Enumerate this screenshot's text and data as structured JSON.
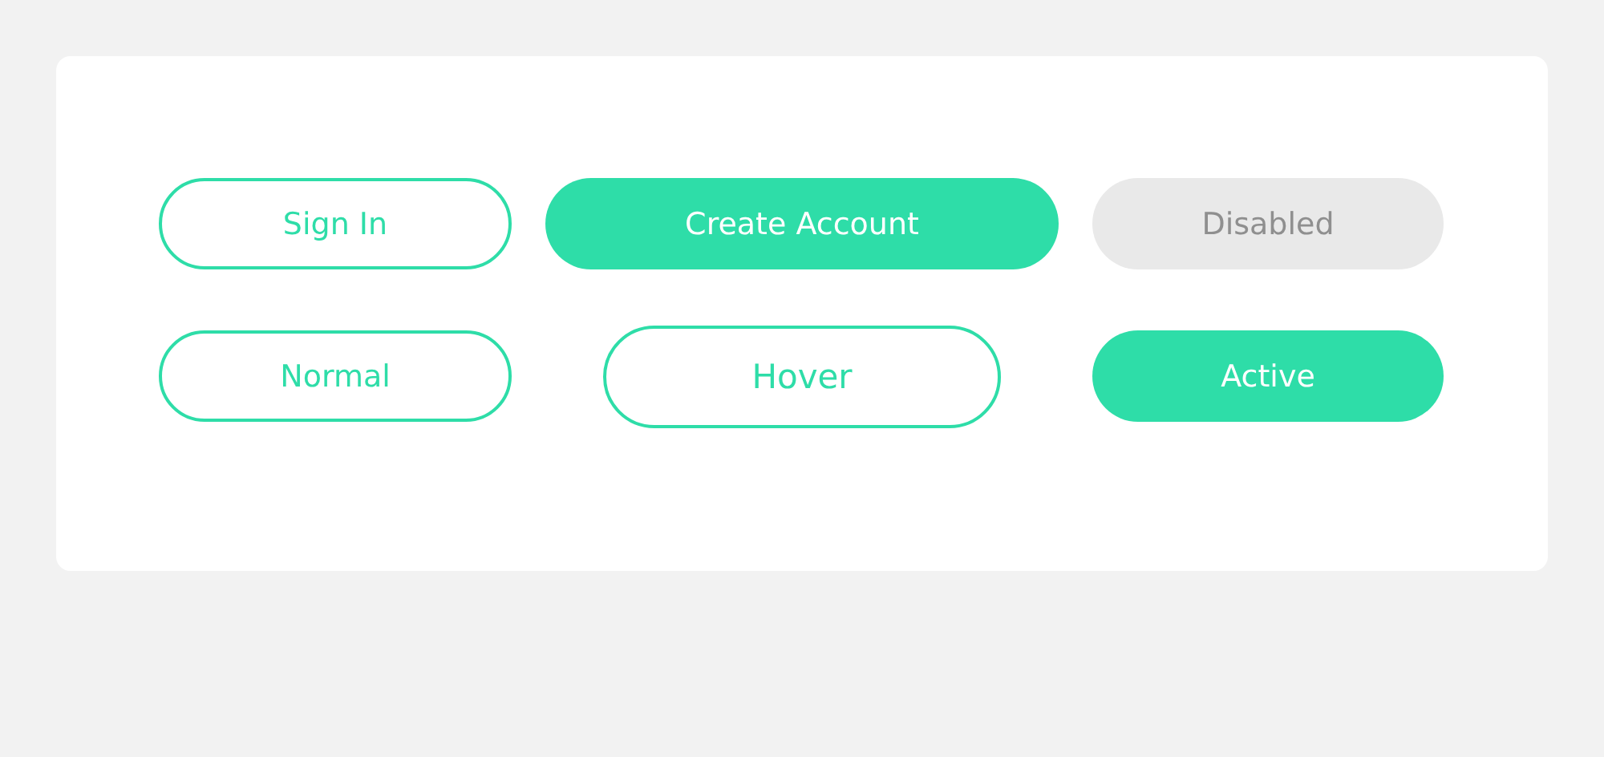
{
  "buttons": [
    {
      "label": "Sign In",
      "kind": "outline"
    },
    {
      "label": "Create Account",
      "kind": "filled"
    },
    {
      "label": "Disabled",
      "kind": "disabled"
    },
    {
      "label": "Normal",
      "kind": "outline"
    },
    {
      "label": "Hover",
      "kind": "hover"
    },
    {
      "label": "Active",
      "kind": "filled"
    }
  ]
}
